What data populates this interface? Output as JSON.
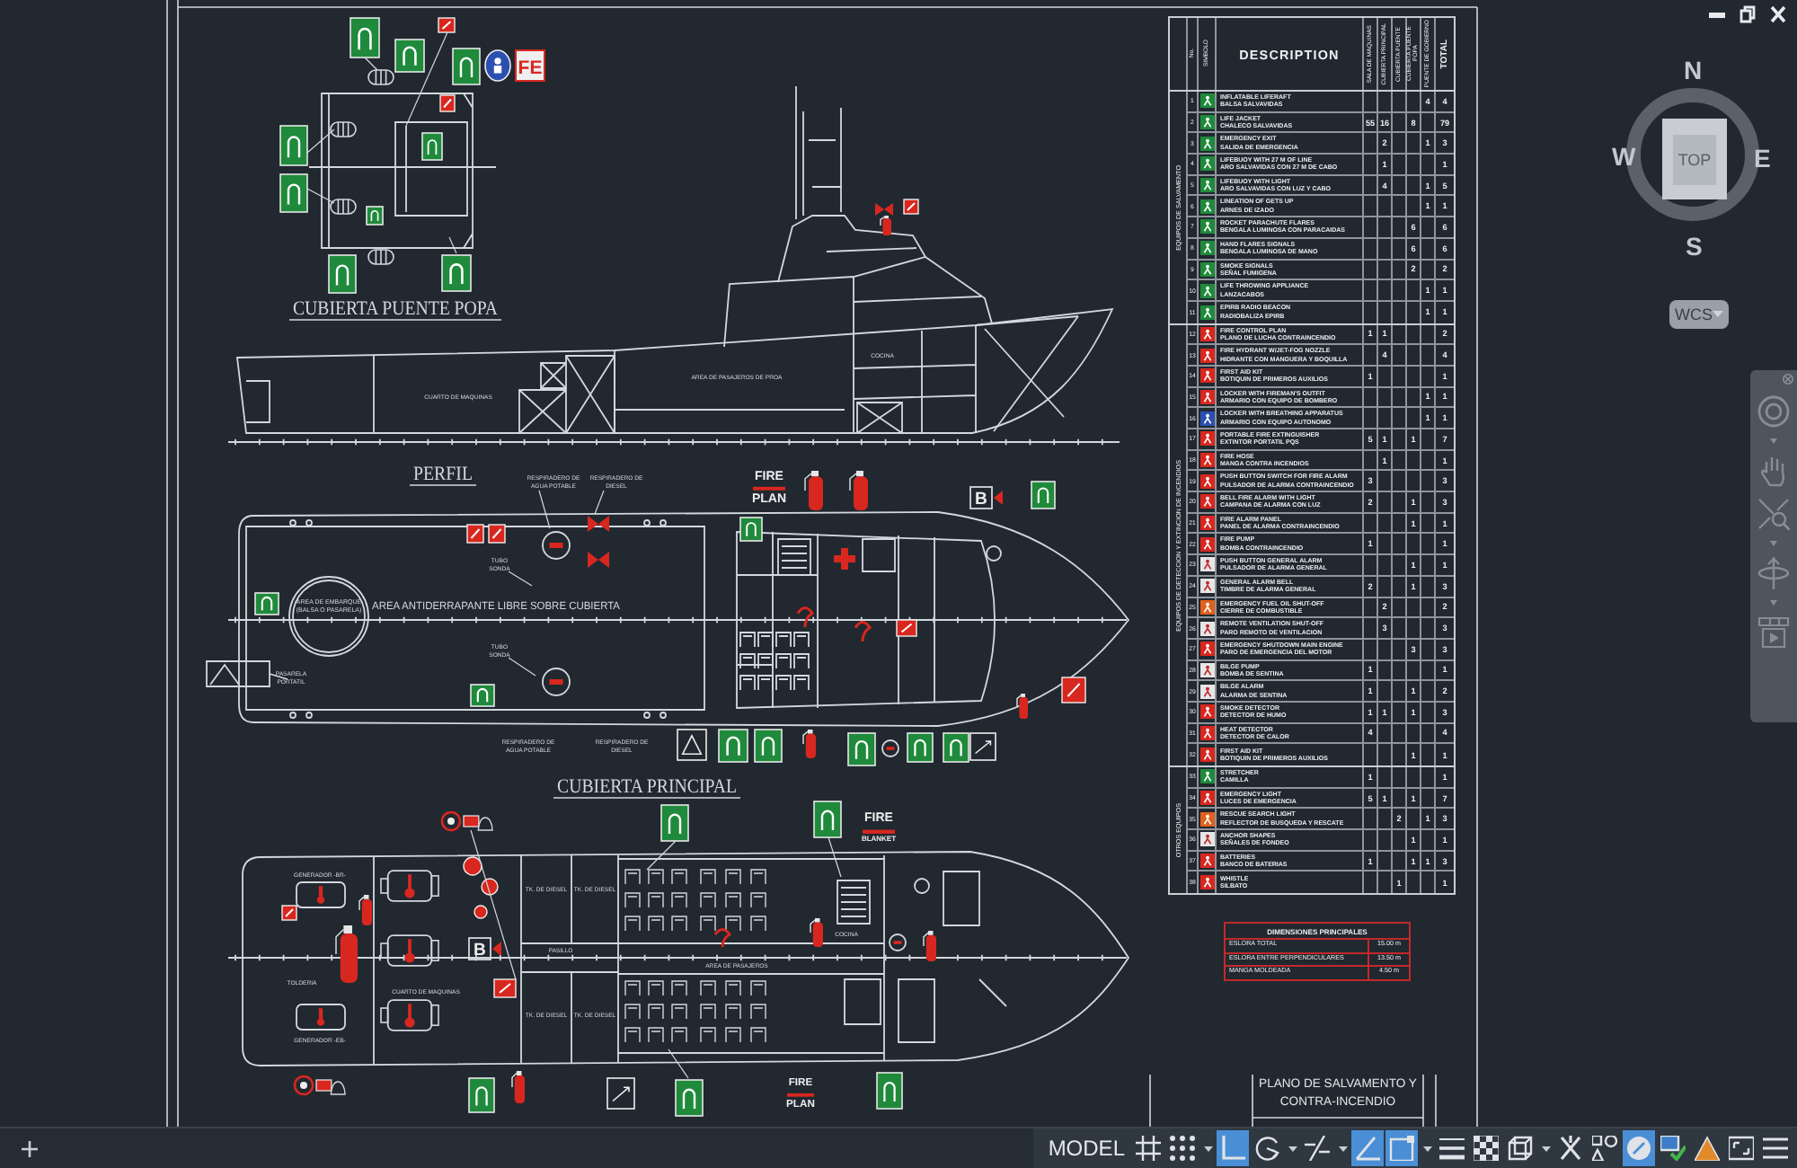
{
  "drawing": {
    "views": [
      {
        "kind": "bridge_deck",
        "title": "CUBIERTA PUENTE POPA",
        "signs": [
          {
            "kind": "letters",
            "lines": [
              "FE"
            ]
          }
        ]
      },
      {
        "kind": "profile",
        "title": "PERFIL",
        "labels": [
          {
            "lines": [
              "COCINA"
            ]
          },
          {
            "lines": [
              "AREA DE PASAJEROS DE PROA"
            ]
          },
          {
            "lines": [
              "CUARTO DE MAQUINAS"
            ]
          }
        ]
      },
      {
        "kind": "main_deck",
        "title": "CUBIERTA PRINCIPAL",
        "labels": [
          {
            "lines": [
              "RESPIRADERO DE",
              "AGUA POTABLE"
            ]
          },
          {
            "lines": [
              "RESPIRADERO DE",
              "DIESEL"
            ]
          },
          {
            "lines": [
              "TUBO",
              "SONDA"
            ]
          },
          {
            "lines": [
              "AREA DE EMBARQUE",
              "(BALSA O PASARELA)"
            ]
          },
          {
            "lines": [
              "AREA ANTIDERRAPANTE LIBRE SOBRE CUBIERTA"
            ]
          },
          {
            "lines": [
              "TUBO",
              "SONDA"
            ]
          },
          {
            "lines": [
              "PASARELA",
              "PORTATIL"
            ]
          },
          {
            "lines": [
              "RESPIRADERO DE",
              "AGUA POTABLE"
            ]
          },
          {
            "lines": [
              "RESPIRADERO DE",
              "DIESEL"
            ]
          }
        ],
        "signs": [
          {
            "kind": "plan",
            "lines": [
              "FIRE",
              "PLAN"
            ]
          },
          {
            "kind": "letter_box",
            "lines": [
              "B"
            ]
          }
        ]
      },
      {
        "kind": "lower_deck",
        "labels": [
          {
            "lines": [
              "GENERADOR -BR-"
            ]
          },
          {
            "lines": [
              "TK. DE DIESEL"
            ]
          },
          {
            "lines": [
              "TK. DE DIESEL"
            ]
          },
          {
            "lines": [
              "COCINA"
            ]
          },
          {
            "lines": [
              "PASILLO"
            ]
          },
          {
            "lines": [
              "AREA DE PASAJEROS"
            ]
          },
          {
            "lines": [
              "TOLDERIA"
            ]
          },
          {
            "lines": [
              "CUARTO DE MAQUINAS"
            ]
          },
          {
            "lines": [
              "TK. DE DIESEL"
            ]
          },
          {
            "lines": [
              "TK. DE DIESEL"
            ]
          },
          {
            "lines": [
              "GENERADOR -EB-"
            ]
          }
        ],
        "signs": [
          {
            "kind": "plan",
            "lines": [
              "FIRE",
              "BLANKET"
            ]
          },
          {
            "kind": "letter_box",
            "lines": [
              "B"
            ]
          },
          {
            "kind": "plan",
            "lines": [
              "FIRE",
              "PLAN"
            ]
          }
        ]
      }
    ]
  },
  "symbol_table": {
    "headers": {
      "number": "No.",
      "symbol": "SIMBOLO",
      "description": "DESCRIPTION",
      "columns": [
        "SALA DE MAQUINAS",
        "CUBIERTA PRINCIPAL",
        "CUBIERTA PUENTE",
        "CUBIERTA PUENTE POPA",
        "PUENTE DE GOBIERNO"
      ],
      "total": "TOTAL"
    },
    "sections": [
      {
        "label": "EQUIPOS DE SALVAMENTO",
        "rows": [
          {
            "no": "1",
            "color": "#1f8a3b",
            "en": "INFLATABLE LIFERAFT",
            "es": "BALSA SALVAVIDAS",
            "counts": {
              "column_5": "4"
            },
            "total": "4"
          },
          {
            "no": "2",
            "color": "#1f8a3b",
            "en": "LIFE JACKET",
            "es": "CHALECO SALVAVIDAS",
            "counts": {
              "column_1": "55",
              "column_2": "16",
              "column_4": "8"
            },
            "total": "79"
          },
          {
            "no": "3",
            "color": "#1f8a3b",
            "en": "EMERGENCY EXIT",
            "es": "SALIDA DE EMERGENCIA",
            "counts": {
              "column_2": "2",
              "column_5": "1"
            },
            "total": "3"
          },
          {
            "no": "4",
            "color": "#1f8a3b",
            "en": "LIFEBUOY WITH 27 M OF LINE",
            "es": "ARO SALVAVIDAS CON 27 M DE CABO",
            "counts": {
              "column_2": "1"
            },
            "total": "1"
          },
          {
            "no": "5",
            "color": "#1f8a3b",
            "en": "LIFEBUOY WITH LIGHT",
            "es": "ARO SALVAVIDAS CON LUZ Y CABO",
            "counts": {
              "column_2": "4",
              "column_5": "1"
            },
            "total": "5"
          },
          {
            "no": "6",
            "color": "#1f8a3b",
            "en": "LINEATION OF GETS UP",
            "es": "ARNES DE IZADO",
            "counts": {
              "column_5": "1"
            },
            "total": "1"
          },
          {
            "no": "7",
            "color": "#1f8a3b",
            "en": "ROCKET PARACHUTE FLARES",
            "es": "BENGALA LUMINOSA CON PARACAIDAS",
            "counts": {
              "column_4": "6"
            },
            "total": "6"
          },
          {
            "no": "8",
            "color": "#1f8a3b",
            "en": "HAND FLARES SIGNALS",
            "es": "BENGALA LUMINOSA DE MANO",
            "counts": {
              "column_4": "6"
            },
            "total": "6"
          },
          {
            "no": "9",
            "color": "#1f8a3b",
            "en": "SMOKE SIGNALS",
            "es": "SEÑAL FUMIGENA",
            "counts": {
              "column_4": "2"
            },
            "total": "2"
          },
          {
            "no": "10",
            "color": "#1f8a3b",
            "en": "LIFE THROWING APPLIANCE",
            "es": "LANZACABOS",
            "counts": {
              "column_5": "1"
            },
            "total": "1"
          },
          {
            "no": "11",
            "color": "#1f8a3b",
            "en": "EPIRB RADIO BEACON",
            "es": "RADIOBALIZA EPIRB",
            "counts": {
              "column_5": "1"
            },
            "total": "1"
          }
        ]
      },
      {
        "label": "EQUIPOS DE DETECCION Y EXTINCION DE INCENDIOS",
        "rows": [
          {
            "no": "12",
            "color": "#d8271f",
            "en": "FIRE CONTROL PLAN",
            "es": "PLANO DE LUCHA CONTRAINCENDIO",
            "counts": {
              "column_1": "1",
              "column_2": "1"
            },
            "total": "2"
          },
          {
            "no": "13",
            "color": "#d8271f",
            "en": "FIRE HYDRANT W/JET-FOG NOZZLE",
            "es": "HIDRANTE CON MANGUERA Y BOQUILLA",
            "counts": {
              "column_2": "4"
            },
            "total": "4"
          },
          {
            "no": "14",
            "color": "#d8271f",
            "en": "FIRST AID KIT",
            "es": "BOTIQUIN DE PRIMEROS AUXILIOS",
            "counts": {
              "column_1": "1"
            },
            "total": "1"
          },
          {
            "no": "15",
            "color": "#d8271f",
            "en": "LOCKER WITH FIREMAN'S OUTFIT",
            "es": "ARMARIO CON EQUIPO DE BOMBERO",
            "counts": {
              "column_5": "1"
            },
            "total": "1"
          },
          {
            "no": "16",
            "color": "#2b50b0",
            "en": "LOCKER WITH BREATHING APPARATUS",
            "es": "ARMARIO CON EQUIPO AUTONOMO",
            "counts": {
              "column_5": "1"
            },
            "total": "1"
          },
          {
            "no": "17",
            "color": "#d8271f",
            "en": "PORTABLE FIRE EXTINGUISHER",
            "es": "EXTINTOR PORTATIL PQS",
            "counts": {
              "column_1": "5",
              "column_2": "1",
              "column_4": "1"
            },
            "total": "7"
          },
          {
            "no": "18",
            "color": "#d8271f",
            "en": "FIRE HOSE",
            "es": "MANGA CONTRA INCENDIOS",
            "counts": {
              "column_2": "1"
            },
            "total": "1"
          },
          {
            "no": "19",
            "color": "#d8271f",
            "en": "PUSH BUTTON SWITCH FOR FIRE ALARM",
            "es": "PULSADOR DE ALARMA CONTRAINCENDIO",
            "counts": {
              "column_1": "3"
            },
            "total": "3"
          },
          {
            "no": "20",
            "color": "#d8271f",
            "en": "BELL FIRE ALARM WITH LIGHT",
            "es": "CAMPANA DE ALARMA CON LUZ",
            "counts": {
              "column_1": "2",
              "column_4": "1"
            },
            "total": "3"
          },
          {
            "no": "21",
            "color": "#d8271f",
            "en": "FIRE ALARM PANEL",
            "es": "PANEL DE ALARMA CONTRAINCENDIO",
            "counts": {
              "column_4": "1"
            },
            "total": "1"
          },
          {
            "no": "22",
            "color": "#d8271f",
            "en": "FIRE PUMP",
            "es": "BOMBA CONTRAINCENDIO",
            "counts": {
              "column_1": "1"
            },
            "total": "1"
          },
          {
            "no": "23",
            "color": "#e6e6e6",
            "en": "PUSH BUTTON GENERAL ALARM",
            "es": "PULSADOR DE ALARMA GENERAL",
            "counts": {
              "column_4": "1"
            },
            "total": "1"
          },
          {
            "no": "24",
            "color": "#e6e6e6",
            "en": "GENERAL ALARM BELL",
            "es": "TIMBRE DE ALARMA GENERAL",
            "counts": {
              "column_1": "2",
              "column_4": "1"
            },
            "total": "3"
          },
          {
            "no": "25",
            "color": "#e0601c",
            "en": "EMERGENCY FUEL OIL SHUT-OFF",
            "es": "CIERRE DE COMBUSTIBLE",
            "counts": {
              "column_2": "2"
            },
            "total": "2"
          },
          {
            "no": "26",
            "color": "#e6e6e6",
            "en": "REMOTE VENTILATION SHUT-OFF",
            "es": "PARO REMOTO DE VENTILACION",
            "counts": {
              "column_2": "3"
            },
            "total": "3"
          },
          {
            "no": "27",
            "color": "#d8271f",
            "en": "EMERGENCY SHUTDOWN MAIN ENGINE",
            "es": "PARO DE EMERGENCIA DEL MOTOR",
            "counts": {
              "column_4": "3"
            },
            "total": "3"
          },
          {
            "no": "28",
            "color": "#e6e6e6",
            "en": "BILGE PUMP",
            "es": "BOMBA DE SENTINA",
            "counts": {
              "column_1": "1"
            },
            "total": "1"
          },
          {
            "no": "29",
            "color": "#e6e6e6",
            "en": "BILGE ALARM",
            "es": "ALARMA DE SENTINA",
            "counts": {
              "column_1": "1",
              "column_4": "1"
            },
            "total": "2"
          },
          {
            "no": "30",
            "color": "#d8271f",
            "en": "SMOKE DETECTOR",
            "es": "DETECTOR DE HUMO",
            "counts": {
              "column_1": "1",
              "column_2": "1",
              "column_4": "1"
            },
            "total": "3"
          },
          {
            "no": "31",
            "color": "#d8271f",
            "en": "HEAT DETECTOR",
            "es": "DETECTOR DE CALOR",
            "counts": {
              "column_1": "4"
            },
            "total": "4"
          },
          {
            "no": "32",
            "color": "#d8271f",
            "en": "FIRST AID KIT",
            "es": "BOTIQUIN DE PRIMEROS AUXILIOS",
            "counts": {
              "column_4": "1"
            },
            "total": "1"
          }
        ]
      },
      {
        "label": "OTROS EQUIPOS",
        "rows": [
          {
            "no": "33",
            "color": "#1f8a3b",
            "en": "STRETCHER",
            "es": "CAMILLA",
            "counts": {
              "column_1": "1"
            },
            "total": "1"
          },
          {
            "no": "34",
            "color": "#d8271f",
            "en": "EMERGENCY LIGHT",
            "es": "LUCES DE EMERGENCIA",
            "counts": {
              "column_1": "5",
              "column_2": "1",
              "column_4": "1"
            },
            "total": "7"
          },
          {
            "no": "35",
            "color": "#e0601c",
            "en": "RESCUE SEARCH LIGHT",
            "es": "REFLECTOR DE BUSQUEDA Y RESCATE",
            "counts": {
              "column_3": "2",
              "column_5": "1"
            },
            "total": "3"
          },
          {
            "no": "36",
            "color": "#e6e6e6",
            "en": "ANCHOR SHAPES",
            "es": "SEÑALES DE FONDEO",
            "counts": {
              "column_4": "1"
            },
            "total": "1"
          },
          {
            "no": "37",
            "color": "#d8271f",
            "en": "BATTERIES",
            "es": "BANCO DE BATERIAS",
            "counts": {
              "column_1": "1",
              "column_4": "1",
              "column_5": "1"
            },
            "total": "3"
          },
          {
            "no": "38",
            "color": "#d8271f",
            "en": "WHISTLE",
            "es": "SILBATO",
            "counts": {
              "column_3": "1"
            },
            "total": "1"
          }
        ]
      }
    ]
  },
  "dimensions": {
    "title": "DIMENSIONES PRINCIPALES",
    "rows": [
      {
        "label": "ESLORA TOTAL",
        "value": "15.00 m"
      },
      {
        "label": "ESLORA ENTRE PERPENDICULARES",
        "value": "13.50 m"
      },
      {
        "label": "MANGA MOLDEADA",
        "value": "4.50 m"
      }
    ]
  },
  "title_block": {
    "lines": [
      "PLANO DE SALVAMENTO Y",
      "CONTRA-INCENDIO"
    ]
  },
  "viewcube": {
    "face": "TOP",
    "north": "N",
    "east": "E",
    "south": "S",
    "west": "W",
    "coordinate_system": "WCS"
  },
  "status_bar": {
    "mode": "MODEL",
    "tools": [
      {
        "kind": "grid",
        "on": false
      },
      {
        "kind": "snap",
        "on": false,
        "menu": true
      },
      {
        "kind": "ortho",
        "on": true
      },
      {
        "kind": "polar",
        "on": false,
        "menu": true
      },
      {
        "kind": "tracking",
        "on": false,
        "menu": true
      },
      {
        "kind": "angle",
        "on": true
      },
      {
        "kind": "osnap",
        "on": true,
        "menu": true
      },
      {
        "kind": "lineweight",
        "on": false
      },
      {
        "kind": "transparency",
        "on": false
      },
      {
        "kind": "cycling",
        "on": false,
        "menu": true
      },
      {
        "kind": "annotation",
        "on": false
      },
      {
        "kind": "visibility",
        "on": false
      },
      {
        "kind": "isolate",
        "on": true
      },
      {
        "kind": "hardware",
        "on": false
      },
      {
        "kind": "properties",
        "on": false
      },
      {
        "kind": "fullscreen",
        "on": false
      },
      {
        "kind": "customize",
        "on": false
      }
    ]
  }
}
